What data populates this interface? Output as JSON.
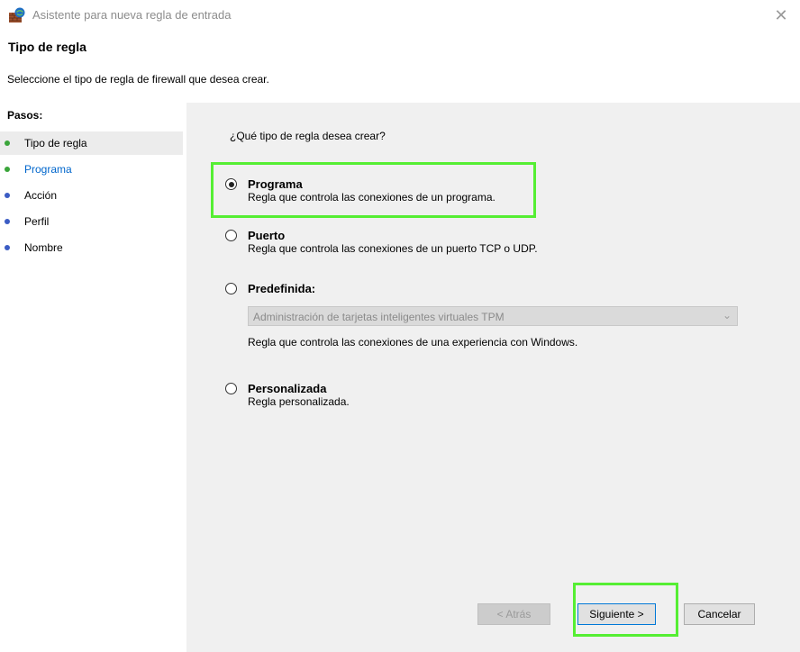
{
  "window": {
    "title": "Asistente para nueva regla de entrada",
    "icon": "firewall-shield-icon",
    "close_symbol": "✕"
  },
  "header": {
    "title": "Tipo de regla",
    "subtitle": "Seleccione el tipo de regla de firewall que desea crear."
  },
  "steps": {
    "header": "Pasos:",
    "items": [
      {
        "label": "Tipo de regla",
        "state": "active"
      },
      {
        "label": "Programa",
        "state": "next"
      },
      {
        "label": "Acción",
        "state": "pending"
      },
      {
        "label": "Perfil",
        "state": "pending"
      },
      {
        "label": "Nombre",
        "state": "pending"
      }
    ]
  },
  "main": {
    "question": "¿Qué tipo de regla desea crear?",
    "options": [
      {
        "title": "Programa",
        "description": "Regla que controla las conexiones de un programa.",
        "selected": true
      },
      {
        "title": "Puerto",
        "description": "Regla que controla las conexiones de un puerto TCP o UDP.",
        "selected": false
      },
      {
        "title": "Predefinida:",
        "selected": false
      },
      {
        "title": "Personalizada",
        "description": "Regla personalizada.",
        "selected": false
      }
    ],
    "predefined_dropdown": {
      "value": "Administración de tarjetas inteligentes virtuales TPM",
      "arrow_icon": "chevron-down-icon",
      "enabled": false
    },
    "predefined_description": "Regla que controla las conexiones de una experiencia con Windows."
  },
  "buttons": {
    "back": "< Atrás",
    "next": "Siguiente >",
    "cancel": "Cancelar"
  },
  "colors": {
    "step_done": "#3aa53a",
    "step_pending": "#3b5cc4",
    "step_next_text": "#0066cc",
    "highlight": "#55ee33",
    "accent": "#0078d7"
  }
}
